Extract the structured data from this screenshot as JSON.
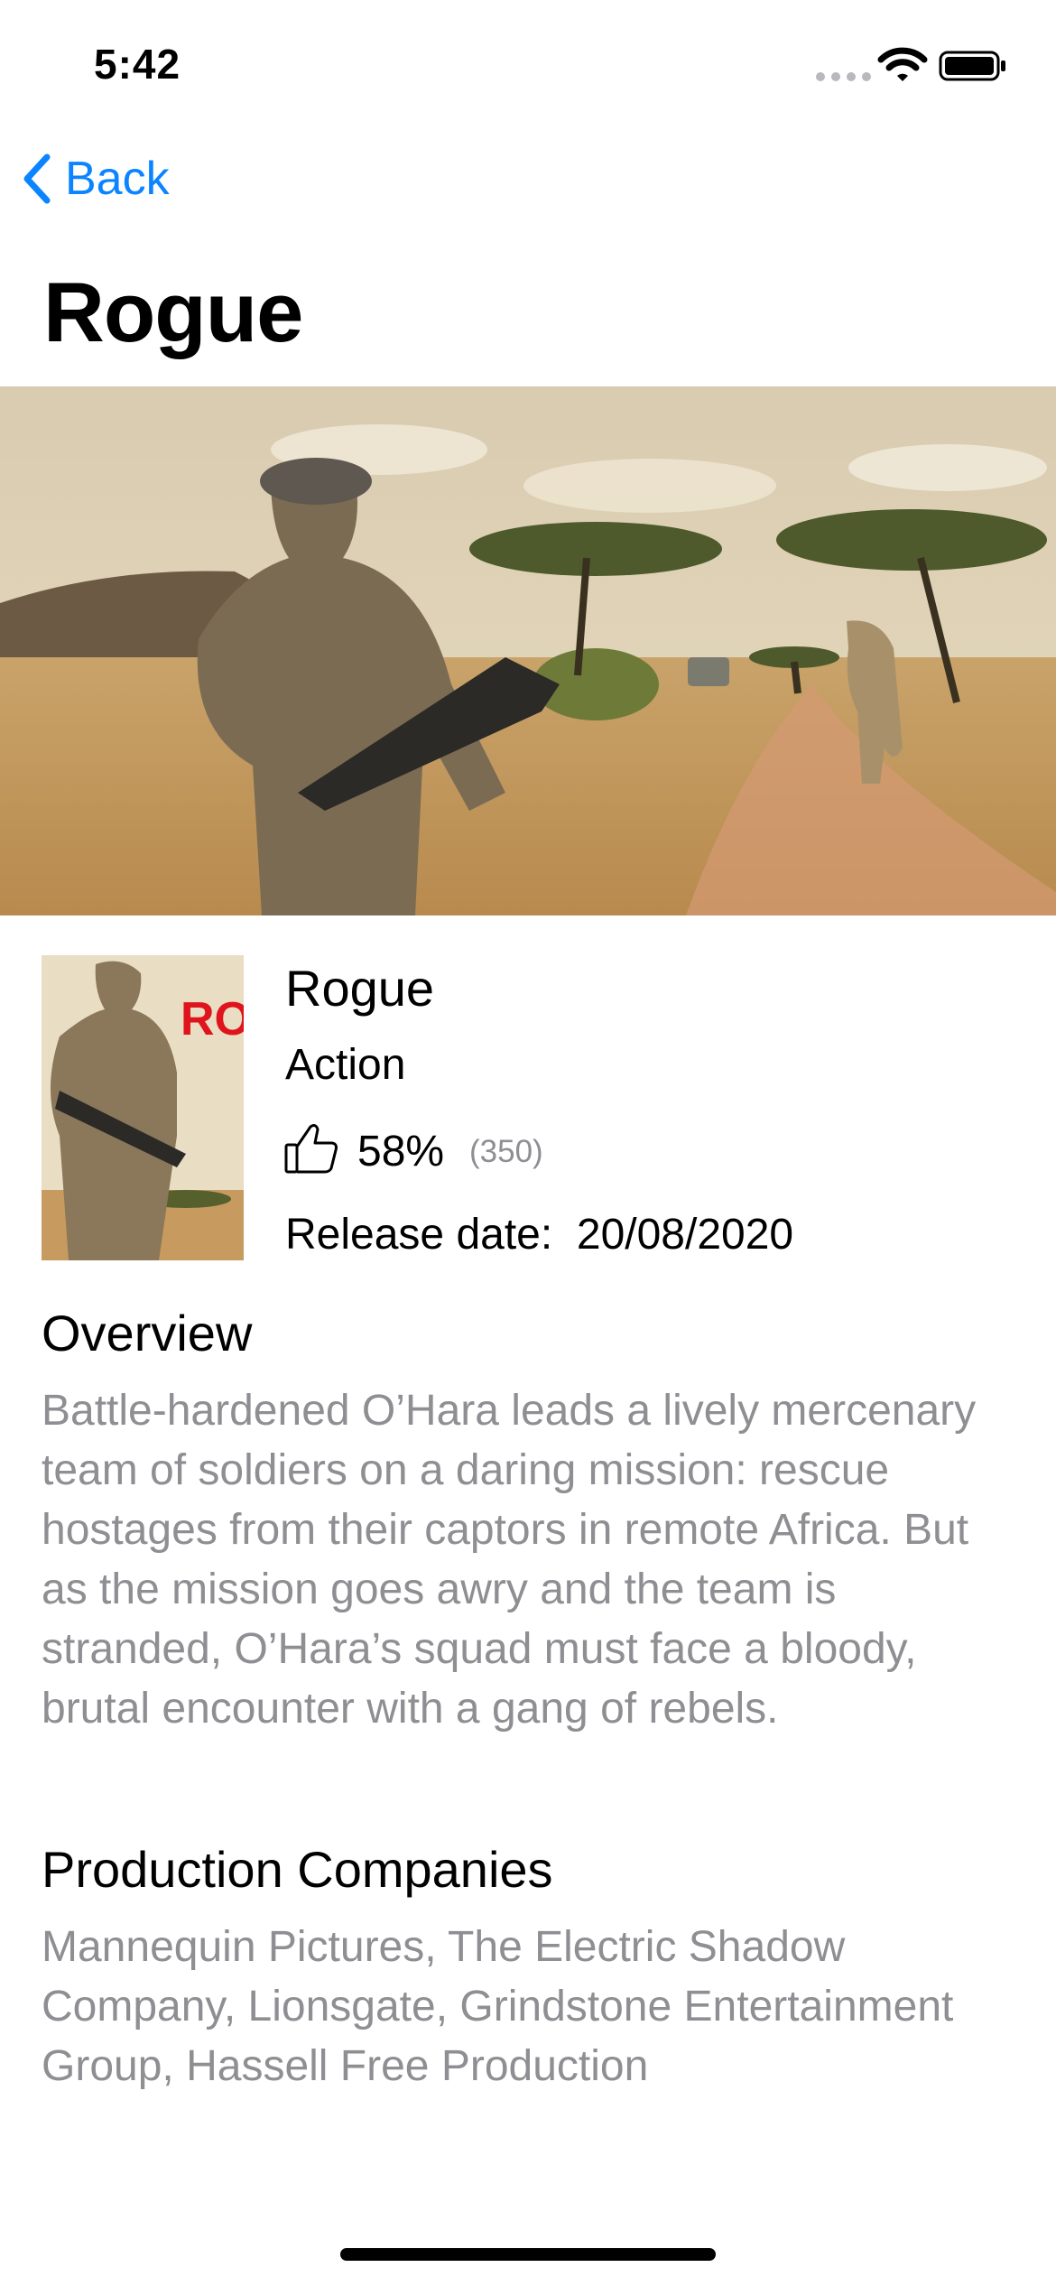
{
  "status_bar": {
    "time": "5:42"
  },
  "nav": {
    "back_label": "Back",
    "title": "Rogue"
  },
  "movie": {
    "title": "Rogue",
    "genre": "Action",
    "rating_percent": "58%",
    "vote_count": "(350)",
    "release_label": "Release date:",
    "release_date": "20/08/2020",
    "poster_title": "ROGUE"
  },
  "overview": {
    "heading": "Overview",
    "text": "Battle-hardened O’Hara leads a lively mercenary team of soldiers on a daring mission: rescue hostages from their captors in remote Africa. But as the mission goes awry and the team is stranded, O’Hara’s squad must face a bloody, brutal encounter with a gang of rebels."
  },
  "production": {
    "heading": "Production Companies",
    "text": "Mannequin Pictures, The Electric Shadow Company, Lionsgate, Grindstone Entertainment Group, Hassell Free Production"
  },
  "colors": {
    "accent": "#0a84ff",
    "secondary_text": "#8e8e93",
    "poster_title": "#e0141c"
  },
  "icons": [
    "signal-icon",
    "wifi-icon",
    "battery-icon",
    "chevron-left-icon",
    "thumbs-up-icon"
  ]
}
